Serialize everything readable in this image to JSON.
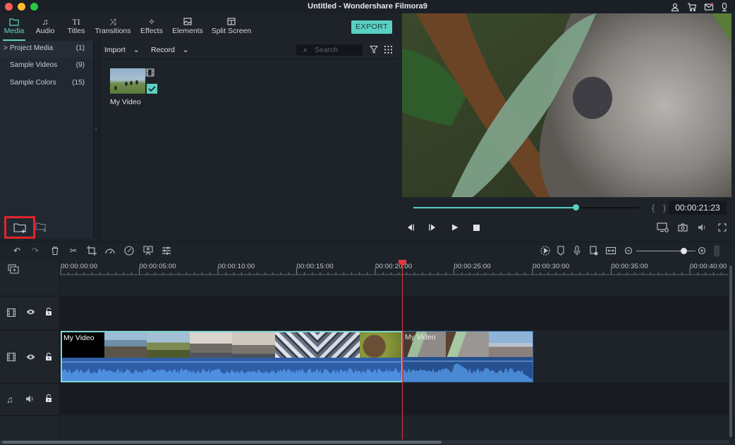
{
  "window": {
    "title": "Untitled - Wondershare Filmora9",
    "traffic_lights": {
      "close": "#fc5d57",
      "minimize": "#fdbc2e",
      "zoom": "#29c840"
    },
    "title_icons": [
      "account-icon",
      "cart-icon",
      "mail-icon",
      "download-icon"
    ]
  },
  "tabs": [
    {
      "label": "Media",
      "icon": "folder-icon",
      "active": true
    },
    {
      "label": "Audio",
      "icon": "music-note-icon"
    },
    {
      "label": "Titles",
      "icon": "text-icon"
    },
    {
      "label": "Transitions",
      "icon": "transition-icon"
    },
    {
      "label": "Effects",
      "icon": "effects-icon"
    },
    {
      "label": "Elements",
      "icon": "image-icon"
    },
    {
      "label": "Split Screen",
      "icon": "split-screen-icon"
    }
  ],
  "export_label": "EXPORT",
  "sidebar": {
    "items": [
      {
        "label": "Project Media",
        "count": "(1)",
        "expanded_marker": ">",
        "active": true
      },
      {
        "label": "Sample Videos",
        "count": "(9)"
      },
      {
        "label": "Sample Colors",
        "count": "(15)"
      }
    ]
  },
  "media_toolbar": {
    "import_label": "Import",
    "record_label": "Record",
    "search_placeholder": "Search"
  },
  "media_items": [
    {
      "name": "My Video",
      "type": "video",
      "used": true
    }
  ],
  "preview": {
    "timecode": "00:00:21:23",
    "progress": 0.72,
    "bracket_in": "{",
    "bracket_out": "}"
  },
  "accent_color": "#5ad0c2",
  "playhead_color": "#e0383c",
  "timeline": {
    "ruler_labels": [
      "00:00:00:00",
      "00:00:05:00",
      "00:00:10:00",
      "00:00:15:00",
      "00:00:20:00",
      "00:00:25:00",
      "00:00:30:00",
      "00:00:35:00",
      "00:00:40:00"
    ],
    "zoom_level": 0.8,
    "playhead_time": "00:00:21:23",
    "clips": [
      {
        "label": "My Video",
        "track": "video-1",
        "start": "00:00:00:00",
        "end": "00:00:21:23"
      },
      {
        "label": "My Video",
        "track": "video-1",
        "start": "00:00:21:23",
        "end": "00:00:30:00"
      }
    ]
  }
}
